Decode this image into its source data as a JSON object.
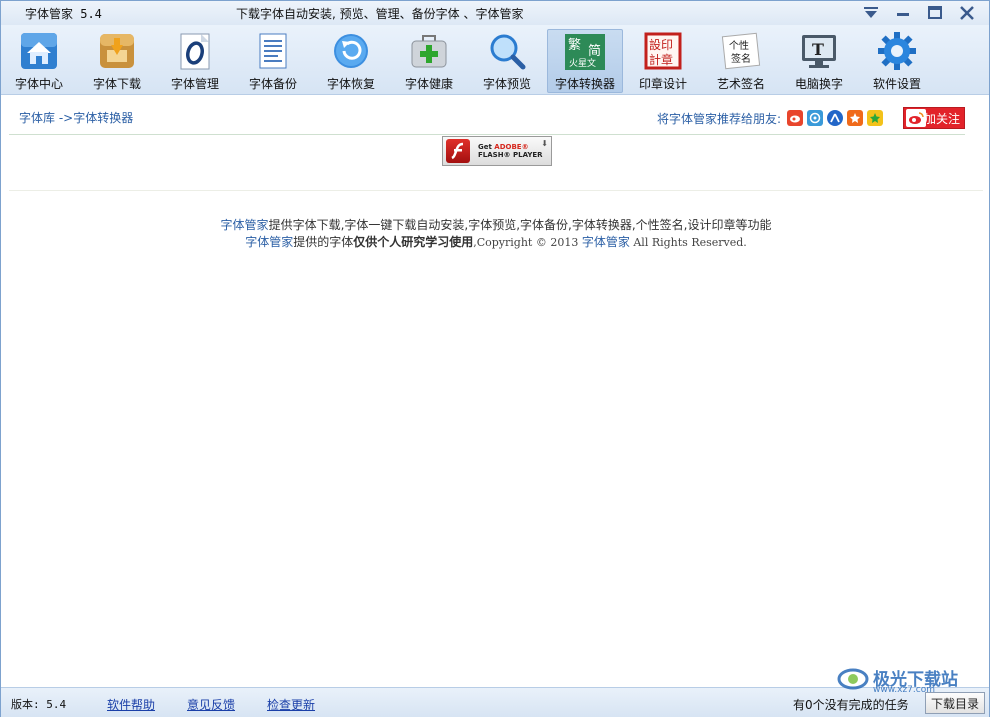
{
  "title": {
    "app_name": "字体管家 5.4",
    "subtitle": "下载字体自动安装, 预览、管理、备份字体 、字体管家"
  },
  "toolbar": {
    "items": [
      {
        "label": "字体中心",
        "icon": "house-icon"
      },
      {
        "label": "字体下载",
        "icon": "download-box-icon"
      },
      {
        "label": "字体管理",
        "icon": "font-o-icon"
      },
      {
        "label": "字体备份",
        "icon": "document-icon"
      },
      {
        "label": "字体恢复",
        "icon": "restore-icon"
      },
      {
        "label": "字体健康",
        "icon": "medical-kit-icon"
      },
      {
        "label": "字体预览",
        "icon": "magnifier-icon"
      },
      {
        "label": "字体转换器",
        "icon": "converter-icon",
        "active": true
      },
      {
        "label": "印章设计",
        "icon": "seal-icon"
      },
      {
        "label": "艺术签名",
        "icon": "signature-icon"
      },
      {
        "label": "电脑换字",
        "icon": "monitor-t-icon"
      },
      {
        "label": "软件设置",
        "icon": "gear-icon"
      }
    ]
  },
  "breadcrumb": {
    "root": "字体库",
    "current": " ->字体转换器"
  },
  "share": {
    "label": "将字体管家推荐给朋友:",
    "follow": "加关注"
  },
  "flash": {
    "line1": "Get ",
    "adobe": "ADOBE®",
    "line2": "FLASH® PLAYER"
  },
  "footer": {
    "line1_link": "字体管家",
    "line1_text": "提供字体下载,字体一键下载自动安装,字体预览,字体备份,字体转换器,个性签名,设计印章等功能",
    "line2_link": "字体管家",
    "line2_text1": "提供的字体",
    "line2_bold": "仅供个人研究学习使用",
    "line2_text2": ",Copyright © 2013 ",
    "line2_link2": "字体管家",
    "line2_text3": "  All Rights Reserved."
  },
  "status": {
    "version": "版本: 5.4",
    "help": "软件帮助",
    "feedback": "意见反馈",
    "update": "检查更新",
    "task": "有0个没有完成的任务",
    "download_dir": "下载目录"
  },
  "watermark": {
    "text": "极光下载站",
    "url": "www.xz7.com"
  },
  "colors": {
    "accent": "#2b5fa5",
    "follow_red": "#e2232a"
  }
}
